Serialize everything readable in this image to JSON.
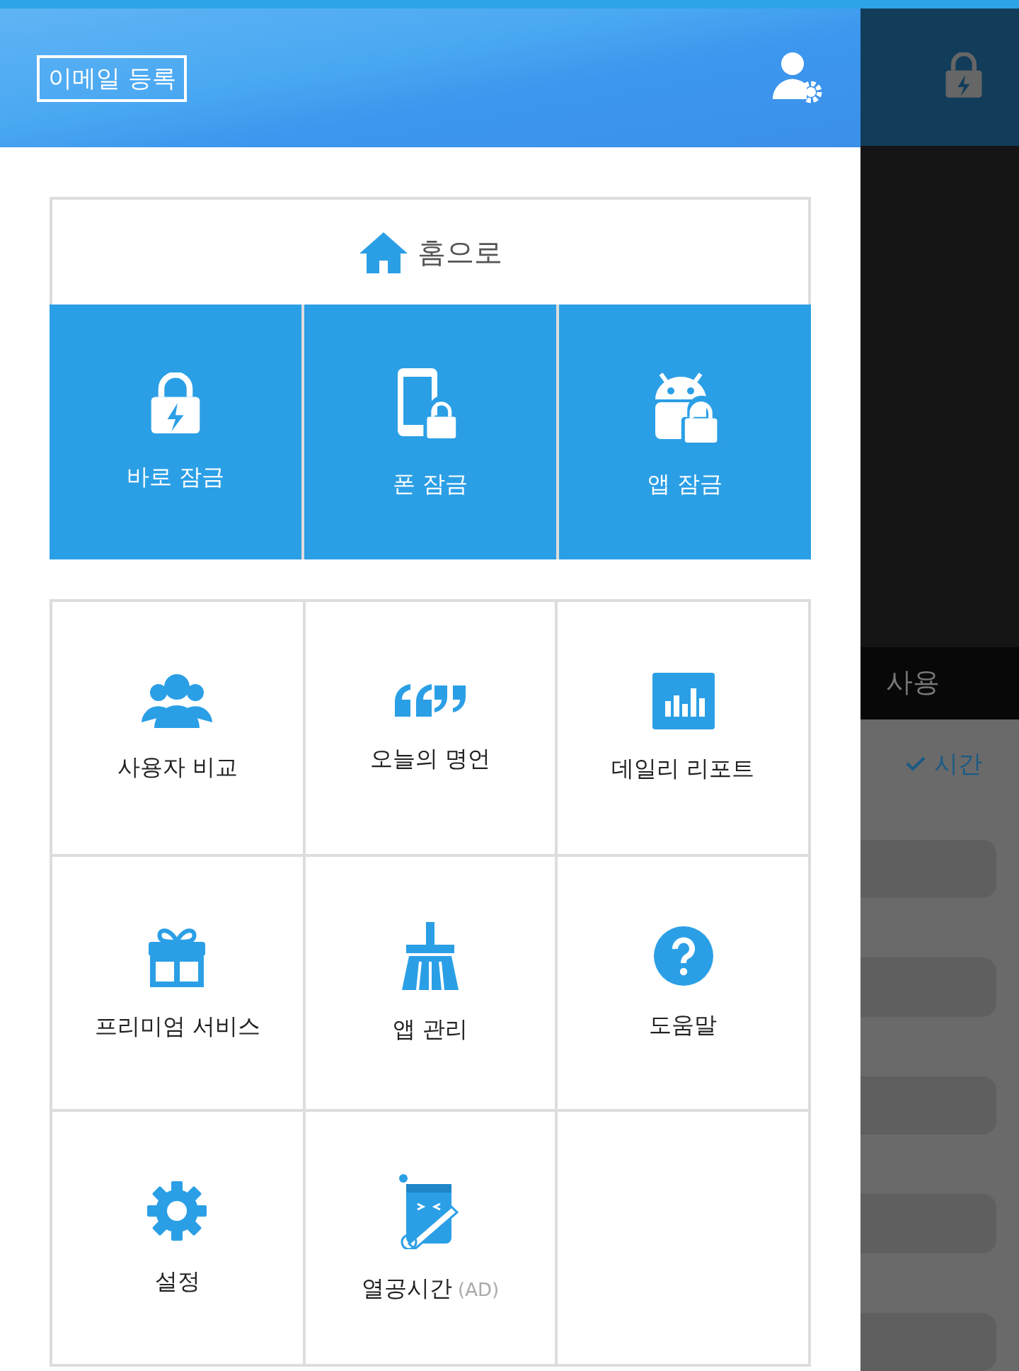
{
  "header": {
    "email_button": "이메일 등록"
  },
  "home_button": "홈으로",
  "quick_locks": [
    {
      "label": "바로 잠금",
      "kind": "instant"
    },
    {
      "label": "폰 잠금",
      "kind": "phone"
    },
    {
      "label": "앱 잠금",
      "kind": "app"
    }
  ],
  "menu": [
    {
      "label": "사용자 비교",
      "kind": "users"
    },
    {
      "label": "오늘의 명언",
      "kind": "quote"
    },
    {
      "label": "데일리 리포트",
      "kind": "chart"
    },
    {
      "label": "프리미엄 서비스",
      "kind": "gift"
    },
    {
      "label": "앱 관리",
      "kind": "broom"
    },
    {
      "label": "도움말",
      "kind": "help"
    },
    {
      "label": "설정",
      "kind": "gear"
    },
    {
      "label": "열공시간",
      "kind": "study",
      "badge": "(AD)"
    }
  ],
  "background": {
    "tab_label": "사용",
    "filter_selected": "시간"
  }
}
